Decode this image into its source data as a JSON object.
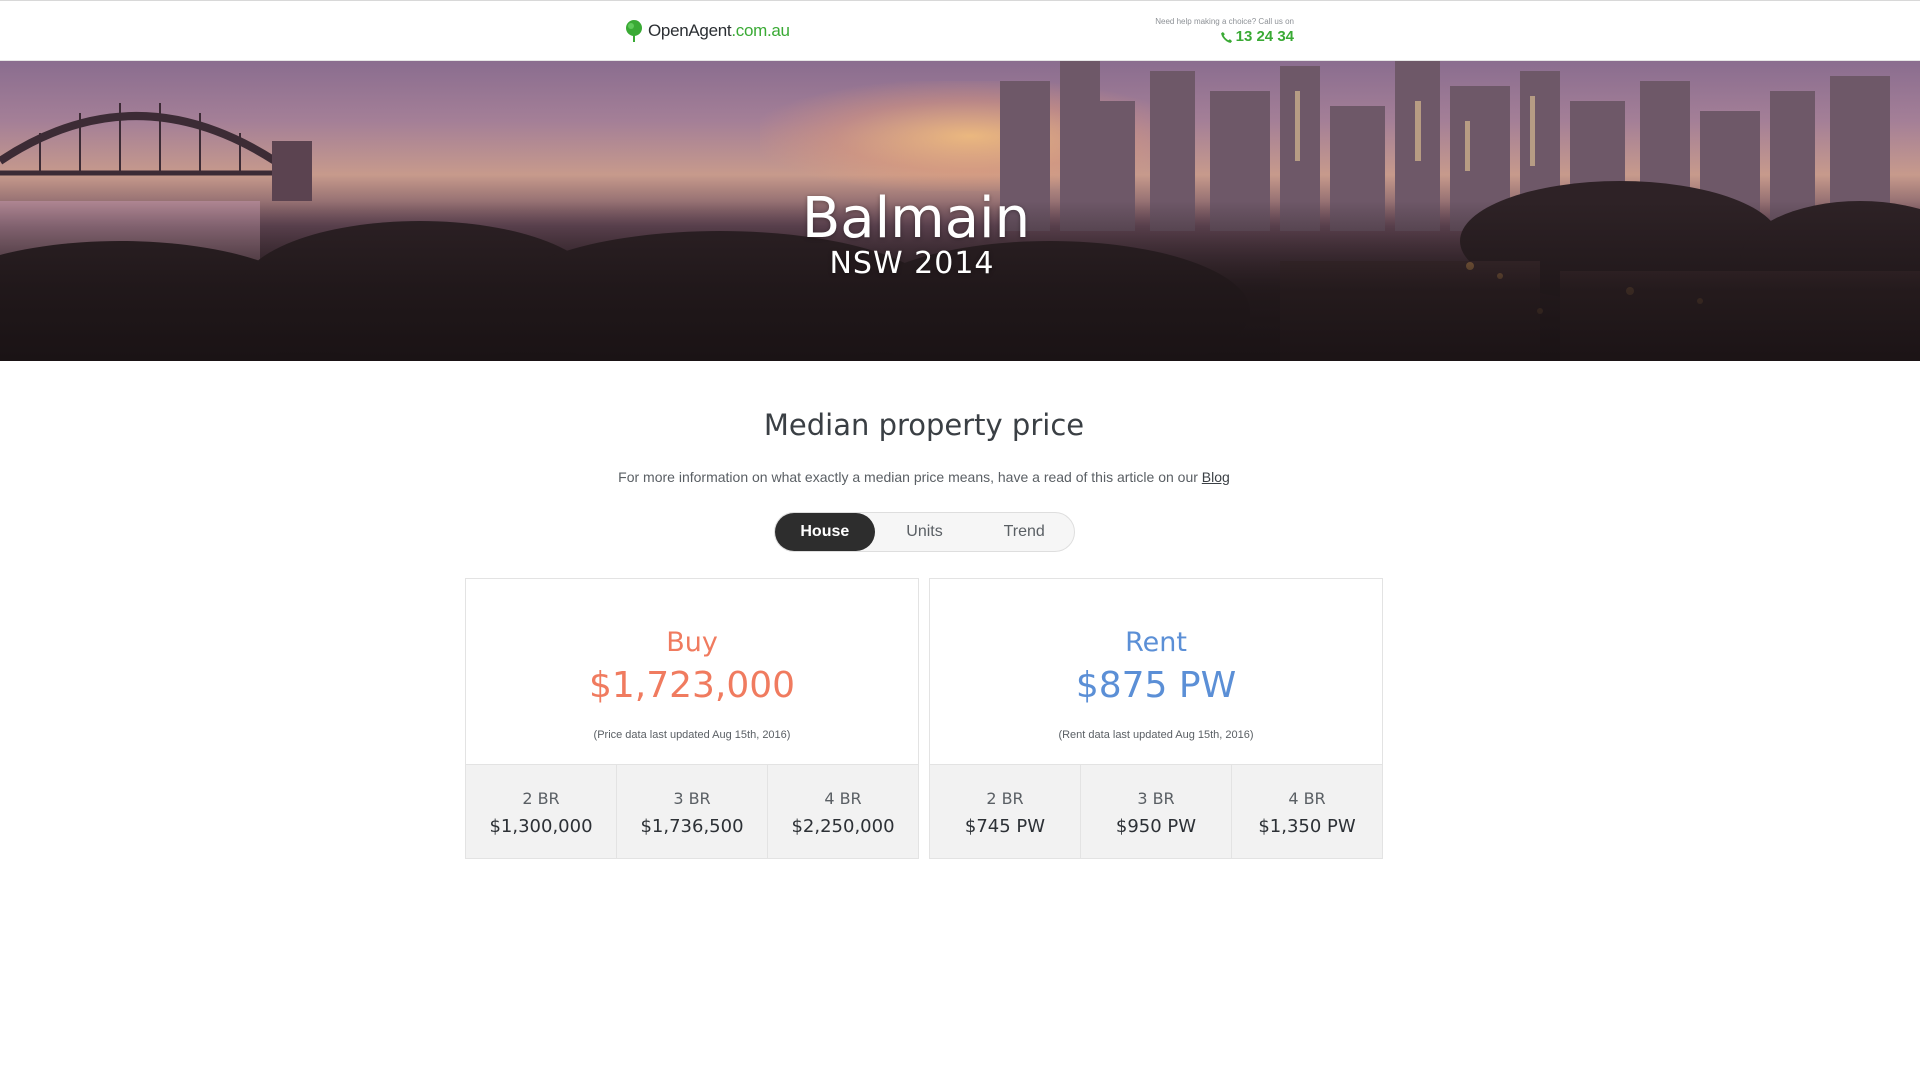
{
  "header": {
    "logo": {
      "part1": "OpenAgent",
      "part2": ".com.au"
    },
    "help_text": "Need help making a choice? Call us on",
    "phone": "13 24 34",
    "icons": {
      "logo": "map-pin-tree-icon",
      "phone": "phone-icon"
    },
    "colors": {
      "brand": "#3aaa35"
    }
  },
  "hero": {
    "suburb": "Balmain",
    "state_postcode": "NSW 2014"
  },
  "main": {
    "title": "Median property price",
    "description": "For more information on what exactly a median price means, have a read of this article on our",
    "description_link": "Blog",
    "tabs": [
      {
        "label": "House",
        "active": true
      },
      {
        "label": "Units",
        "active": false
      },
      {
        "label": "Trend",
        "active": false
      }
    ],
    "buy": {
      "label": "Buy",
      "price": "$1,723,000",
      "note": "(Price data last updated Aug 15th, 2016)",
      "color": "#f07b5f",
      "bedrooms": [
        {
          "label": "2 BR",
          "value": "$1,300,000"
        },
        {
          "label": "3 BR",
          "value": "$1,736,500"
        },
        {
          "label": "4 BR",
          "value": "$2,250,000"
        }
      ]
    },
    "rent": {
      "label": "Rent",
      "price": "$875 PW",
      "note": "(Rent data last updated Aug 15th, 2016)",
      "color": "#5b8fd6",
      "bedrooms": [
        {
          "label": "2 BR",
          "value": "$745 PW"
        },
        {
          "label": "3 BR",
          "value": "$950 PW"
        },
        {
          "label": "4 BR",
          "value": "$1,350 PW"
        }
      ]
    }
  }
}
